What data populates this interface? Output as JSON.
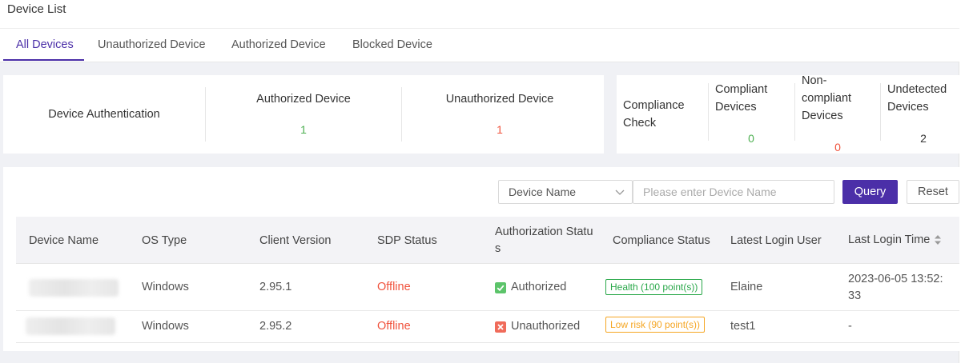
{
  "page": {
    "title": "Device List"
  },
  "tabs": [
    {
      "label": "All Devices",
      "active": true
    },
    {
      "label": "Unauthorized Device",
      "active": false
    },
    {
      "label": "Authorized Device",
      "active": false
    },
    {
      "label": "Blocked Device",
      "active": false
    }
  ],
  "stats": {
    "auth": {
      "label": "Device Authentication",
      "authorized_label": "Authorized Device",
      "authorized_value": "1",
      "unauthorized_label": "Unauthorized Device",
      "unauthorized_value": "1"
    },
    "compliance": {
      "label_line1": "Compliance",
      "label_line2": "Check",
      "compliant_line1": "Compliant",
      "compliant_line2": "Devices",
      "compliant_value": "0",
      "noncompliant_line1": "Non-",
      "noncompliant_line2": "compliant",
      "noncompliant_line3": "Devices",
      "noncompliant_value": "0",
      "undetected_line1": "Undetected",
      "undetected_line2": "Devices",
      "undetected_value": "2"
    }
  },
  "filter": {
    "select_value": "Device Name",
    "search_placeholder": "Please enter Device Name",
    "query_label": "Query",
    "reset_label": "Reset"
  },
  "table": {
    "headers": {
      "device_name": "Device Name",
      "os_type": "OS Type",
      "client_version": "Client Version",
      "sdp_status": "SDP Status",
      "auth_status_line1": "Authorization Statu",
      "auth_status_line2": "s",
      "compliance_status": "Compliance Status",
      "latest_login_user": "Latest Login User",
      "last_login_time": "Last Login Time"
    },
    "rows": [
      {
        "os_type": "Windows",
        "client_version": "2.95.1",
        "sdp_status": "Offline",
        "auth_status": "Authorized",
        "compliance_status": "Health (100 point(s))",
        "latest_login_user": "Elaine",
        "last_login_time_line1": "2023-06-05 13:52:",
        "last_login_time_line2": "33"
      },
      {
        "os_type": "Windows",
        "client_version": "2.95.2",
        "sdp_status": "Offline",
        "auth_status": "Unauthorized",
        "compliance_status": "Low risk (90 point(s))",
        "latest_login_user": "test1",
        "last_login_time_line1": "-",
        "last_login_time_line2": ""
      }
    ]
  },
  "colors": {
    "accent": "#4b2fa8",
    "success": "#4caf50",
    "danger": "#f0523c",
    "warning": "#f5a623"
  },
  "icons": {
    "authorized": "check-shield-icon",
    "unauthorized": "x-shield-icon",
    "sort": "sort-icon",
    "dropdown": "chevron-down-icon"
  }
}
